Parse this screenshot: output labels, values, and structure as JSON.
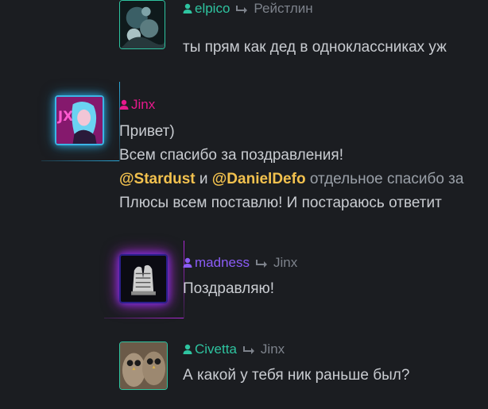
{
  "colors": {
    "background": "#1b1d21",
    "teal": "#2ec4a0",
    "pink": "#e6198c",
    "purple": "#8b5cf6",
    "text": "#c9ccd1",
    "mention": "#f2c14e",
    "reply": "#7d828b"
  },
  "messages": [
    {
      "author": "elpico",
      "reply_icon": "reply-arrow-icon",
      "reply_to": "Рейстлин",
      "lines": [
        "ты прям как дед в одноклассниках уж"
      ]
    },
    {
      "author": "Jinx",
      "lines": [
        "Привет)",
        "Всем спасибо за поздравления!"
      ],
      "mention1": "@Stardust",
      "conj": "и",
      "mention2": "@DanielDefo",
      "mention_tail": "отдельное спасибо за",
      "last_line": "Плюсы всем поставлю! И постараюсь ответит"
    },
    {
      "author": "madness",
      "reply_to": "Jinx",
      "lines": [
        "Поздравляю!"
      ]
    },
    {
      "author": "Civetta",
      "reply_to": "Jinx",
      "lines": [
        "А какой у тебя ник раньше был?"
      ]
    }
  ]
}
